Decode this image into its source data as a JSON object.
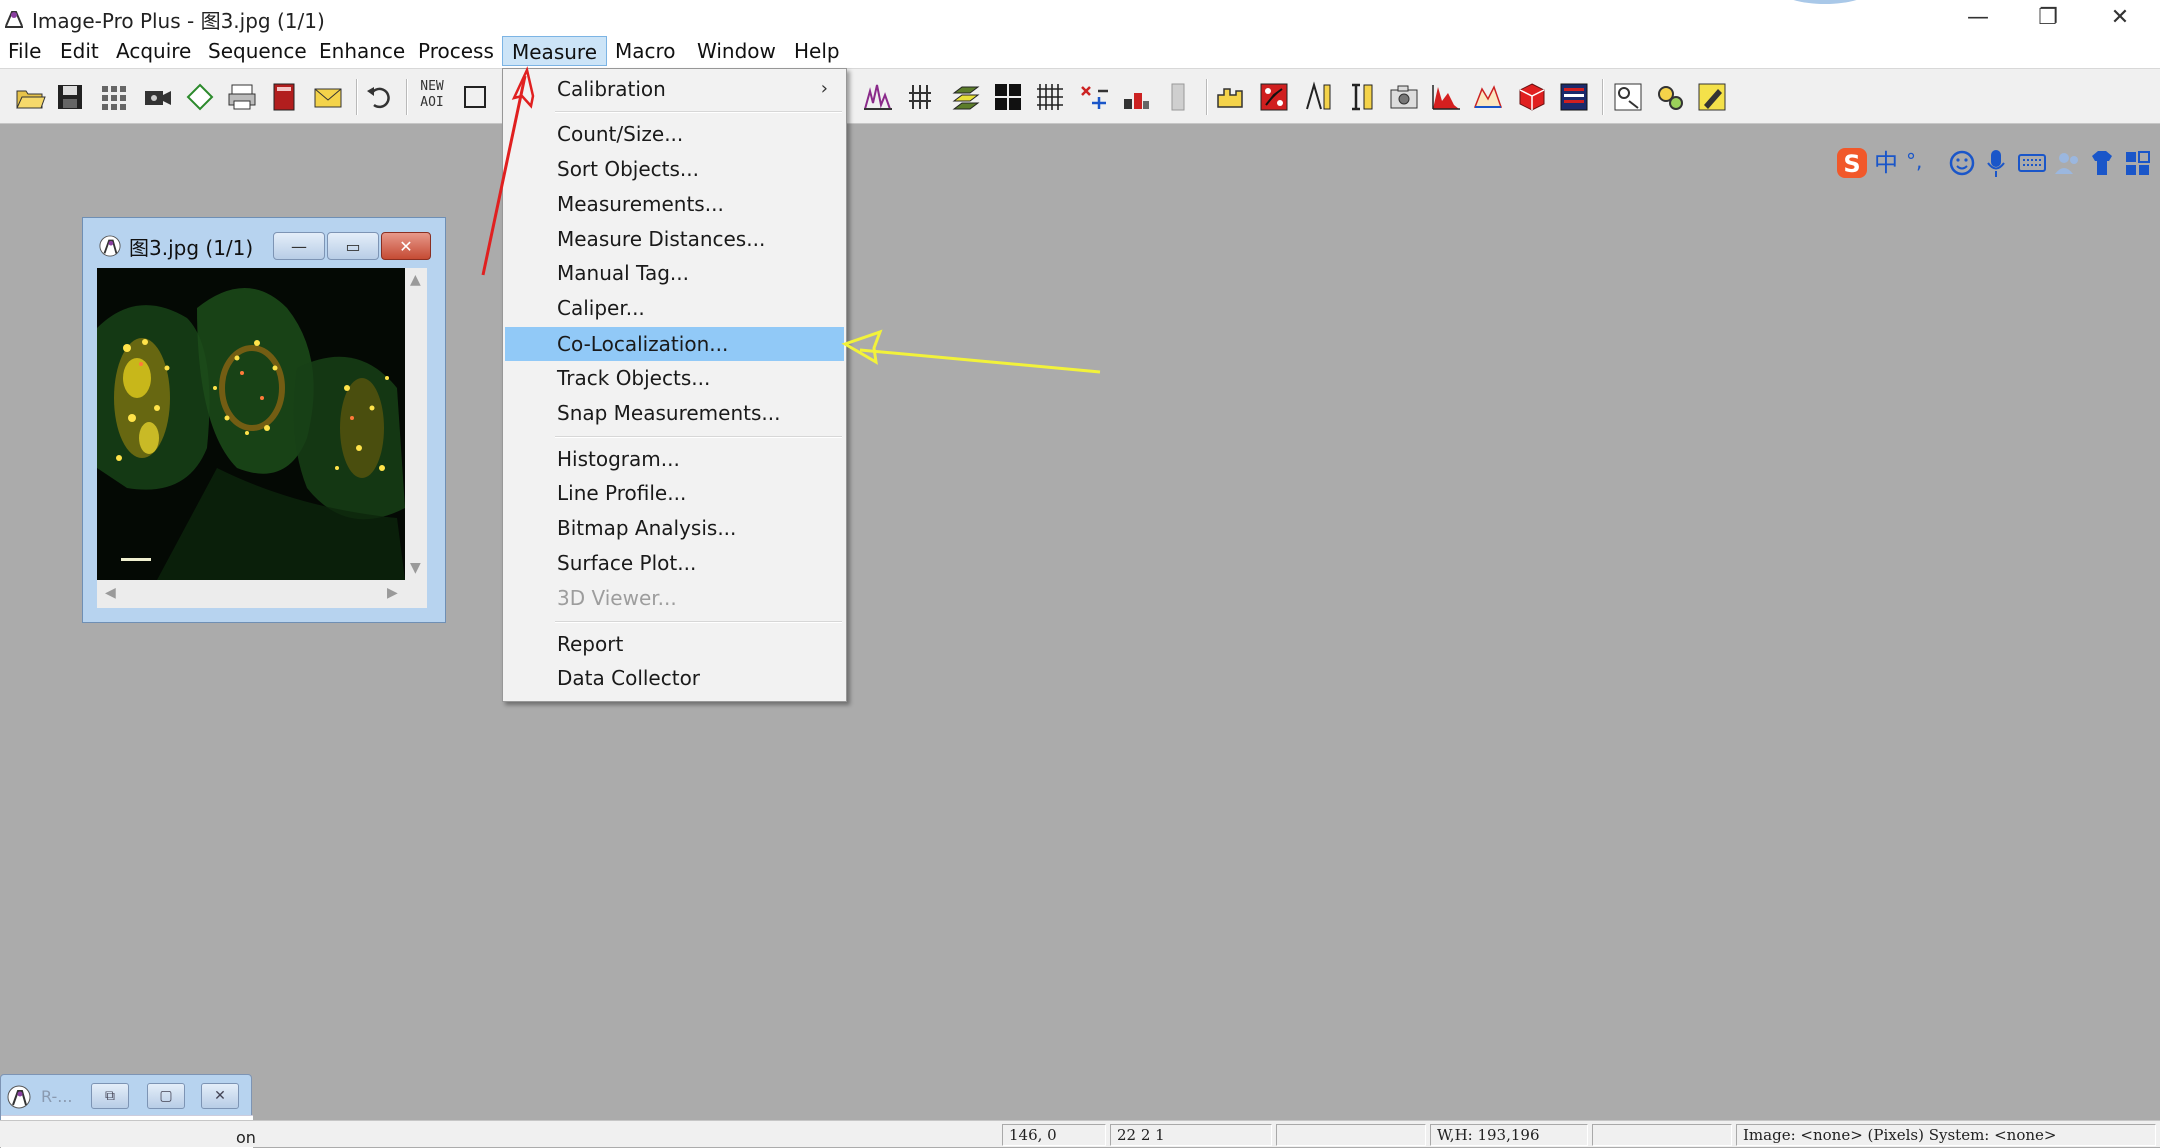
{
  "window": {
    "title": "Image-Pro Plus - 图3.jpg (1/1)",
    "min_glyph": "—",
    "restore_glyph": "❐",
    "close_glyph": "✕"
  },
  "menubar": {
    "items": [
      "File",
      "Edit",
      "Acquire",
      "Sequence",
      "Enhance",
      "Process",
      "Measure",
      "Macro",
      "Window",
      "Help"
    ],
    "active": "Measure"
  },
  "toolbar": {
    "new_aoi_label_line1": "NEW",
    "new_aoi_label_line2": "AOI",
    "icons": [
      "open-icon",
      "save-icon",
      "grid-icon",
      "camera-icon",
      "rotate-icon",
      "print-icon",
      "book-icon",
      "mail-icon",
      "undo-icon",
      "new-aoi-icon",
      "rectangle-icon",
      "histogram-peaks-icon",
      "line-profile-icon",
      "layers-icon",
      "quad-icon",
      "grid-cross-icon",
      "plus-minus-icon",
      "measure-blocks-icon",
      "bar-icon",
      "hand-icon",
      "dice-icon",
      "ruler-icon",
      "caliper-icon",
      "snapshot-icon",
      "red-histogram-icon",
      "surface-plot-icon",
      "cube-icon",
      "report-icon",
      "macro-icon",
      "gears-icon",
      "pencil-icon"
    ]
  },
  "ime": {
    "icons": [
      "sogou-icon",
      "chinese-mode-icon",
      "punctuation-icon",
      "emoji-icon",
      "mic-icon",
      "keyboard-icon",
      "users-icon",
      "shirt-icon",
      "grid-apps-icon"
    ],
    "chinese_glyph": "中",
    "punct_glyph": "°,"
  },
  "image_window": {
    "title": "图3.jpg (1/1)",
    "min_glyph": "—",
    "max_glyph": "▭",
    "close_glyph": "✕"
  },
  "measure_menu": {
    "items": [
      {
        "label": "Calibration",
        "submenu": true,
        "state": "normal"
      },
      {
        "label": "Count/Size...",
        "state": "normal"
      },
      {
        "label": "Sort Objects...",
        "state": "normal"
      },
      {
        "label": "Measurements...",
        "state": "normal"
      },
      {
        "label": "Measure Distances...",
        "state": "normal"
      },
      {
        "label": "Manual Tag...",
        "state": "normal"
      },
      {
        "label": "Caliper...",
        "state": "normal"
      },
      {
        "label": "Co-Localization...",
        "state": "highlighted"
      },
      {
        "label": "Track Objects...",
        "state": "normal"
      },
      {
        "label": "Snap Measurements...",
        "state": "normal"
      },
      {
        "label": "Histogram...",
        "state": "normal"
      },
      {
        "label": "Line Profile...",
        "state": "normal"
      },
      {
        "label": "Bitmap Analysis...",
        "state": "normal"
      },
      {
        "label": "Surface Plot...",
        "state": "normal"
      },
      {
        "label": "3D Viewer...",
        "state": "disabled"
      },
      {
        "label": "Report",
        "state": "normal"
      },
      {
        "label": "Data Collector",
        "state": "normal"
      }
    ],
    "submenu_glyph": "›",
    "annotation_colors": {
      "red_arrow": "#e02020",
      "yellow_arrow": "#f2f23a"
    }
  },
  "mini_window": {
    "title": "R-...",
    "btn1": "⧉",
    "btn2": "▢",
    "btn3": "✕",
    "lower_btn2": "▢",
    "lower_btn3": "✕"
  },
  "statusbar": {
    "left_text": "on",
    "cells": [
      "146,   0",
      "22    2    1",
      "",
      "W,H: 193,196",
      "",
      "Image: <none> (Pixels) System: <none>"
    ]
  }
}
